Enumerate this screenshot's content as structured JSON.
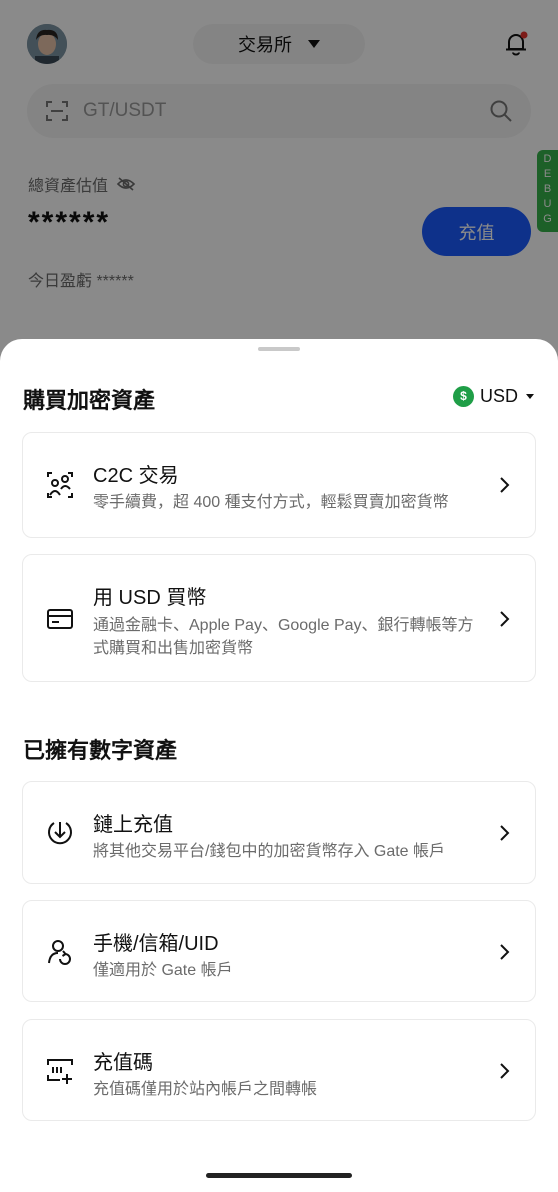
{
  "background": {
    "exchange_label": "交易所",
    "search_placeholder": "GT/USDT",
    "total_assets_label": "總資產估值",
    "total_assets_value": "******",
    "deposit_button": "充值",
    "today_pnl": "今日盈虧 ******",
    "debug_label": "DEBUG"
  },
  "sheet": {
    "title": "購買加密資產",
    "currency": "USD",
    "currency_symbol": "$",
    "buy_options": [
      {
        "title": "C2C 交易",
        "desc": "零手續費，超 400 種支付方式，輕鬆買賣加密貨幣",
        "icon": "c2c-trade-icon"
      },
      {
        "title": "用 USD 買幣",
        "desc": "通過金融卡、Apple Pay、Google Pay、銀行轉帳等方式購買和出售加密貨幣",
        "icon": "card-icon"
      }
    ],
    "owned_title": "已擁有數字資產",
    "owned_options": [
      {
        "title": "鏈上充值",
        "desc": "將其他交易平台/錢包中的加密貨幣存入 Gate 帳戶",
        "icon": "download-icon"
      },
      {
        "title": "手機/信箱/UID",
        "desc": "僅適用於 Gate 帳戶",
        "icon": "user-transfer-icon"
      },
      {
        "title": "充值碼",
        "desc": "充值碼僅用於站內帳戶之間轉帳",
        "icon": "deposit-code-icon"
      }
    ]
  },
  "colors": {
    "accent": "#1a5cff",
    "usd_badge": "#1f9e47",
    "debug": "#36b24a",
    "notification_dot": "#e5322d"
  }
}
